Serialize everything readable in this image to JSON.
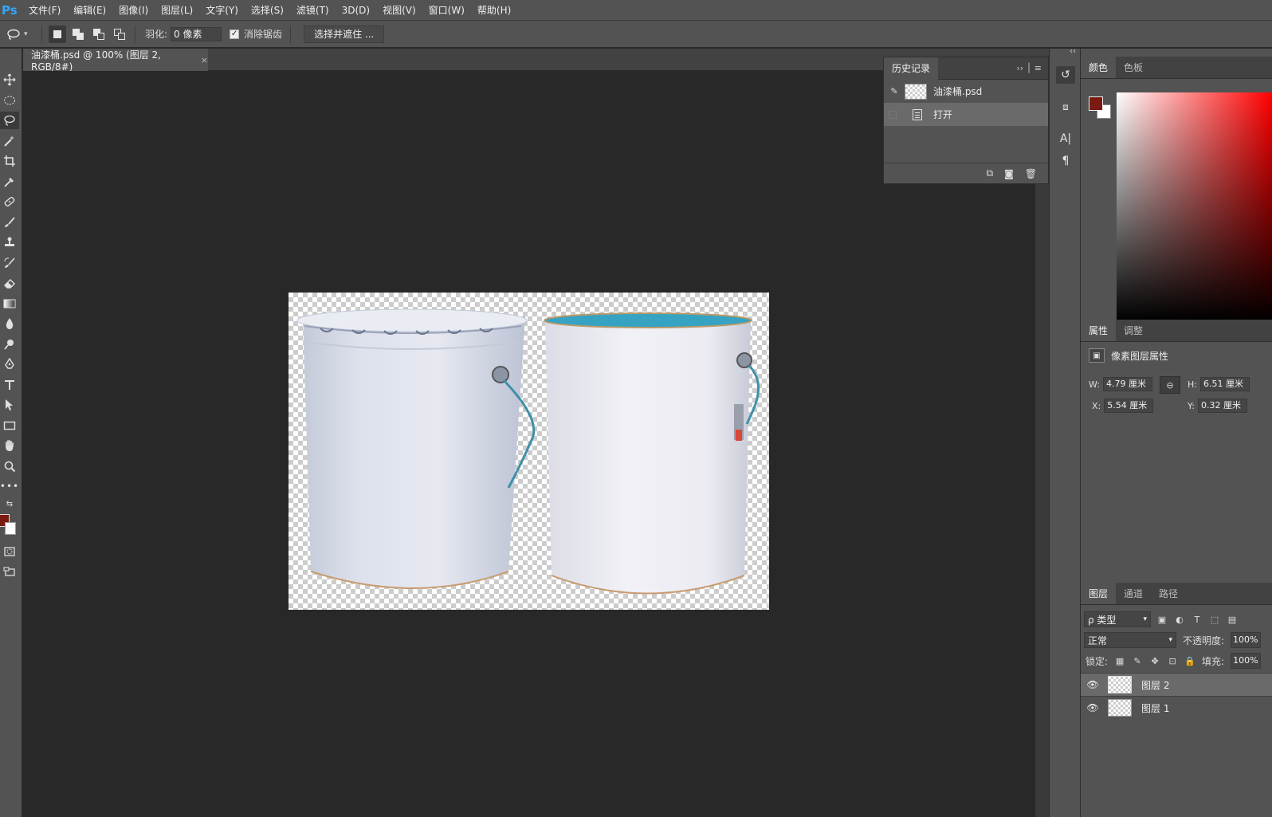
{
  "app": {
    "logo": "Ps",
    "colors": {
      "accent": "#31a8ff",
      "foreground_swatch": "#7a1a12",
      "background_swatch": "#ffffff"
    }
  },
  "menu": [
    "文件(F)",
    "编辑(E)",
    "图像(I)",
    "图层(L)",
    "文字(Y)",
    "选择(S)",
    "滤镜(T)",
    "3D(D)",
    "视图(V)",
    "窗口(W)",
    "帮助(H)"
  ],
  "options_bar": {
    "feather_label": "羽化:",
    "feather_value": "0 像素",
    "antialias_label": "消除锯齿",
    "antialias_checked": true,
    "select_mask_label": "选择并遮住 ..."
  },
  "document": {
    "tab_title": "油漆桶.psd @ 100% (图层 2, RGB/8#)",
    "close_glyph": "×"
  },
  "history": {
    "tab": "历史记录",
    "expand_glyph": "›› │ ≡",
    "snapshot_name": "油漆桶.psd",
    "step_name": "打开",
    "footer_icons": [
      "new-document-from-state-icon",
      "camera-icon",
      "trash-icon"
    ]
  },
  "color_panel": {
    "tabs": [
      "颜色",
      "色板"
    ],
    "collapse_glyph": "‹‹"
  },
  "properties": {
    "tabs": [
      "属性",
      "调整"
    ],
    "title": "像素图层属性",
    "w_label": "W:",
    "w_value": "4.79 厘米",
    "h_label": "H:",
    "h_value": "6.51 厘米",
    "x_label": "X:",
    "x_value": "5.54 厘米",
    "y_label": "Y:",
    "y_value": "0.32 厘米"
  },
  "layers": {
    "tabs": [
      "图层",
      "通道",
      "路径"
    ],
    "kind_filter": "ρ 类型",
    "blend_mode": "正常",
    "opacity_label": "不透明度:",
    "opacity_value": "100%",
    "lock_label": "锁定:",
    "fill_label": "填充:",
    "fill_value": "100%",
    "items": [
      {
        "name": "图层 2",
        "visible": true,
        "selected": true
      },
      {
        "name": "图层 1",
        "visible": true,
        "selected": false
      }
    ]
  }
}
